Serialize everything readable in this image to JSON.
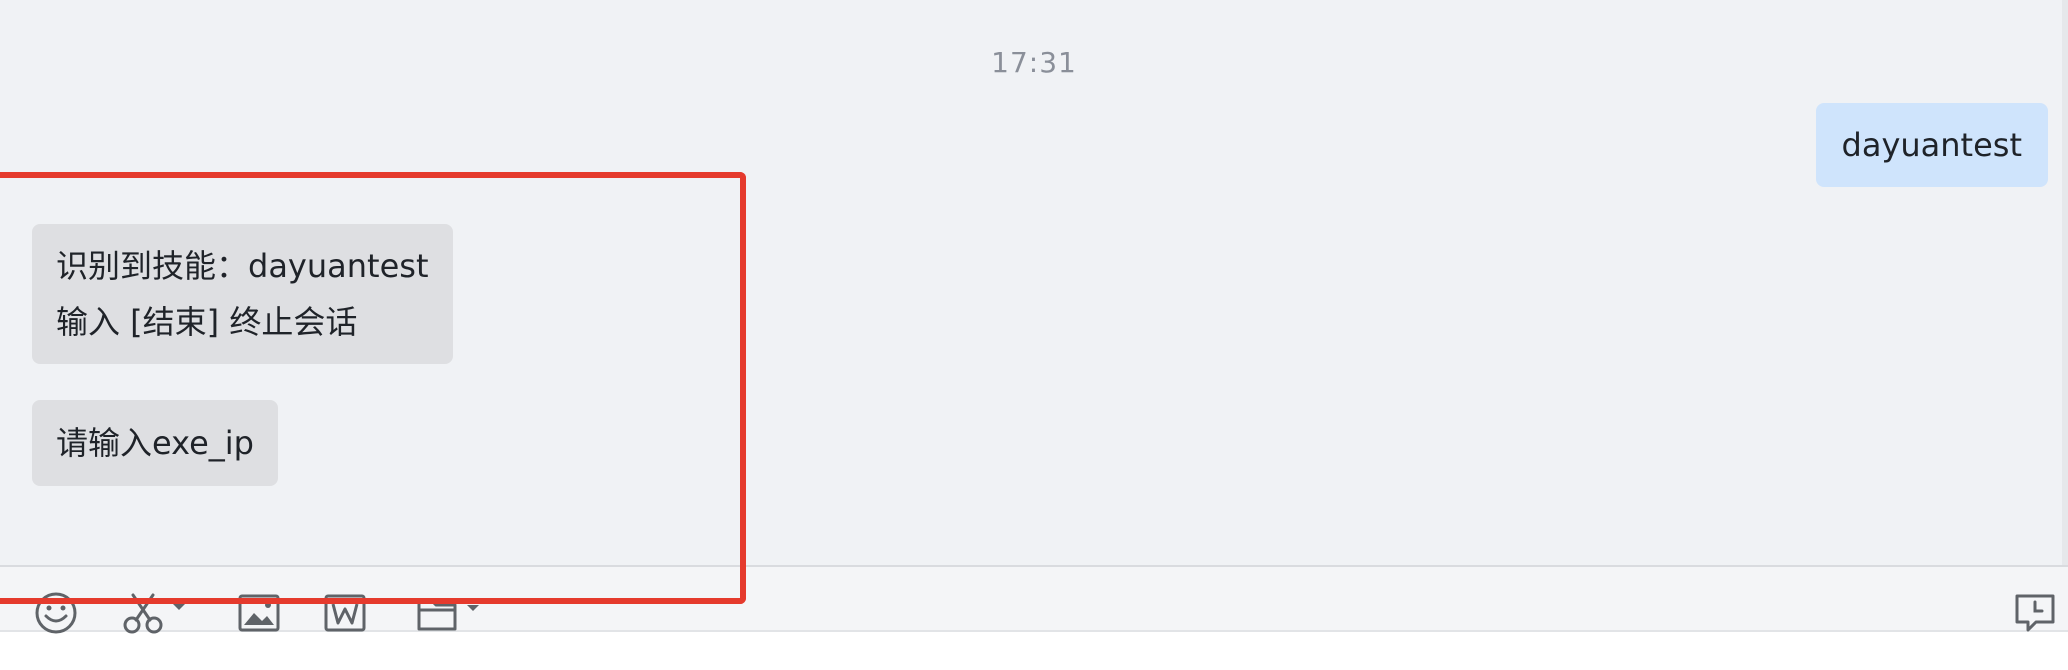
{
  "chat": {
    "timestamp": "17:31",
    "outgoing_message": "dayuantest",
    "incoming_messages": {
      "skill_line1": "识别到技能：dayuantest",
      "skill_line2": "输入 [结束] 终止会话",
      "prompt": "请输入exe_ip"
    }
  },
  "toolbar": {
    "icons": [
      "emoji-icon",
      "screenshot-scissors-icon",
      "image-icon",
      "word-document-icon",
      "folder-icon",
      "chat-history-icon"
    ]
  },
  "colors": {
    "chat_background": "#f0f2f5",
    "outgoing_bubble": "#cfe4fc",
    "incoming_bubble": "#dedfe2",
    "highlight_border": "#e53a2d",
    "icon_stroke": "#5f6368"
  }
}
